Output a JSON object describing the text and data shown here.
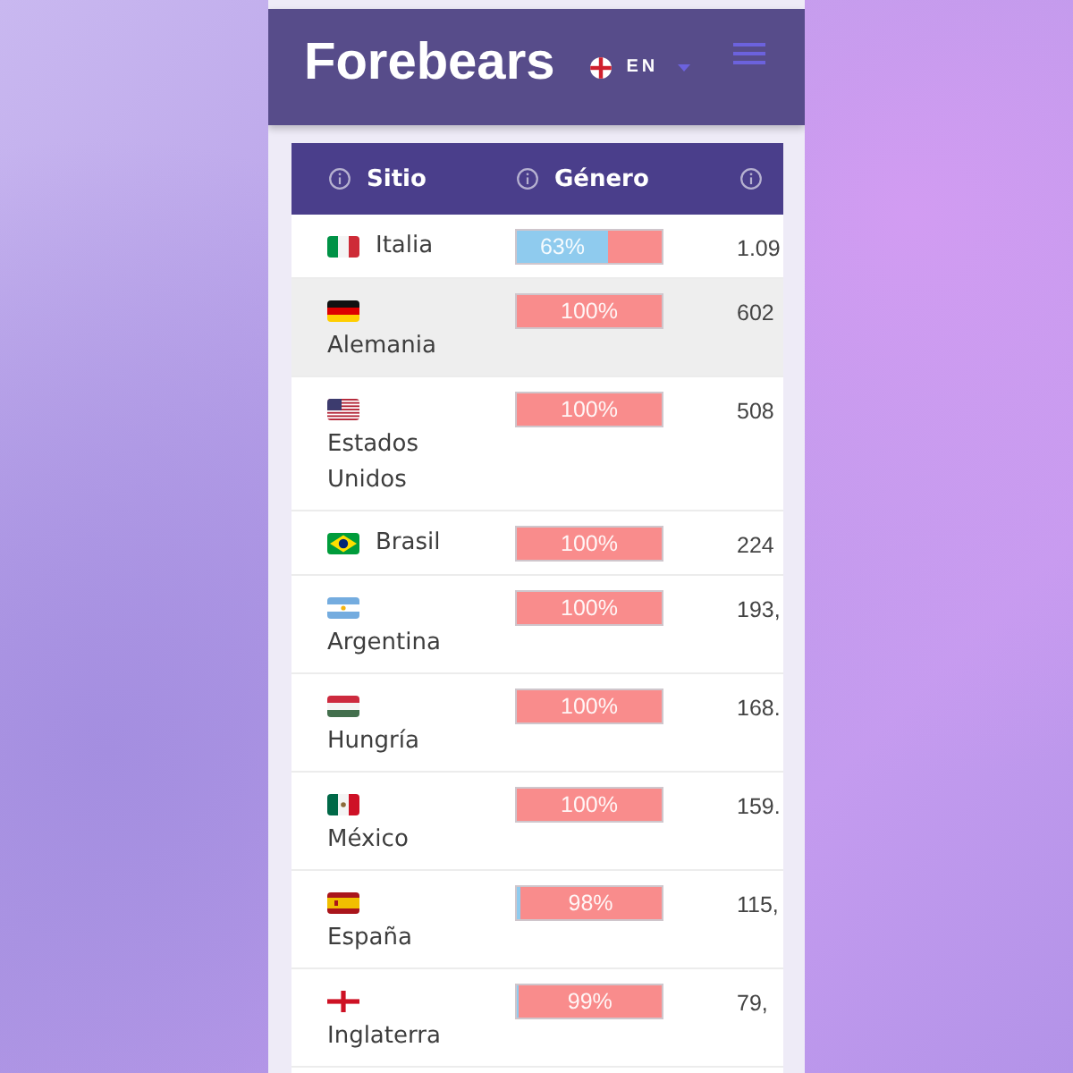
{
  "header": {
    "logo": "Forebears",
    "language": {
      "code": "EN",
      "kind": "england"
    }
  },
  "table": {
    "columns": [
      {
        "kind": "labeled",
        "label": "Sitio"
      },
      {
        "kind": "labeled",
        "label": "Género"
      },
      {
        "kind": "icon-only"
      }
    ],
    "rows": [
      {
        "country": "Italia",
        "kind": "italy",
        "selected": false,
        "gender": {
          "label": "63%",
          "level": 0.37
        },
        "column_3": "1.09"
      },
      {
        "country": "Alemania",
        "kind": "germany",
        "selected": true,
        "gender": {
          "label": "100%",
          "level": 1
        },
        "column_3": "602"
      },
      {
        "country": "Estados Unidos",
        "kind": "usa",
        "selected": false,
        "gender": {
          "label": "100%",
          "level": 1
        },
        "column_3": "508"
      },
      {
        "country": "Brasil",
        "kind": "brazil",
        "selected": false,
        "gender": {
          "label": "100%",
          "level": 1
        },
        "column_3": "224"
      },
      {
        "country": "Argentina",
        "kind": "argentina",
        "selected": false,
        "gender": {
          "label": "100%",
          "level": 1
        },
        "column_3": "193,"
      },
      {
        "country": "Hungría",
        "kind": "hungary",
        "selected": false,
        "gender": {
          "label": "100%",
          "level": 1
        },
        "column_3": "168."
      },
      {
        "country": "México",
        "kind": "mexico",
        "selected": false,
        "gender": {
          "label": "100%",
          "level": 1
        },
        "column_3": "159."
      },
      {
        "country": "España",
        "kind": "spain",
        "selected": false,
        "gender": {
          "label": "98%",
          "level": 0.98
        },
        "column_3": "115,"
      },
      {
        "country": "Inglaterra",
        "kind": "england",
        "selected": false,
        "gender": {
          "label": "99%",
          "level": 0.99
        },
        "column_3": "79,"
      }
    ]
  }
}
